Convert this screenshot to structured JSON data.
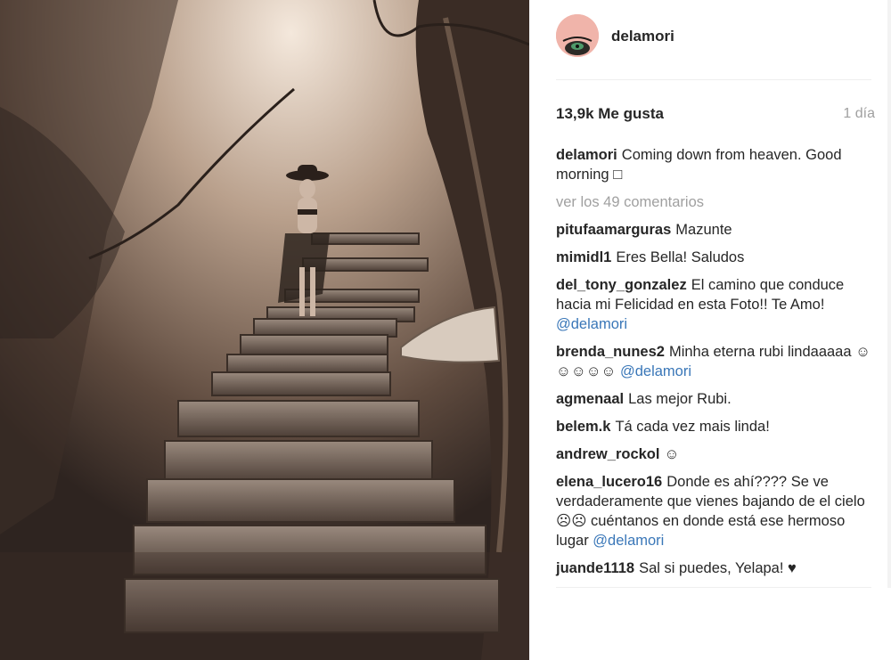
{
  "post": {
    "username": "delamori",
    "likes": "13,9k Me gusta",
    "time": "1 día",
    "caption_text": "Coming down from heaven. Good morning □",
    "view_all": "ver los 49 comentarios"
  },
  "comments": [
    {
      "user": "pitufaamarguras",
      "text": "Mazunte",
      "mention": ""
    },
    {
      "user": "mimidl1",
      "text": "Eres Bella! Saludos",
      "mention": ""
    },
    {
      "user": "del_tony_gonzalez",
      "text": "El camino que conduce hacia mi Felicidad en esta Foto!! Te Amo!",
      "mention": "@delamori"
    },
    {
      "user": "brenda_nunes2",
      "text": "Minha eterna rubi lindaaaaa ☺☺☺☺☺",
      "mention": "@delamori"
    },
    {
      "user": "agmenaal",
      "text": "Las mejor Rubi.",
      "mention": ""
    },
    {
      "user": "belem.k",
      "text": "Tá cada vez mais linda!",
      "mention": ""
    },
    {
      "user": "andrew_rockol",
      "text": "☺",
      "mention": ""
    },
    {
      "user": "elena_lucero16",
      "text": "Donde es ahí???? Se ve verdaderamente que vienes bajando de el cielo ☹☹ cuéntanos en donde está ese hermoso lugar",
      "mention": "@delamori"
    },
    {
      "user": "juande1118",
      "text": "Sal si puedes, Yelapa! ♥",
      "mention": ""
    }
  ],
  "colors": {
    "mention": "#3a77b8",
    "muted": "#a0a0a0",
    "text": "#262626",
    "photo_tone": "sepia"
  },
  "icons": {
    "avatar": "profile-avatar",
    "photo": "post-photo-jungle-stairs"
  }
}
